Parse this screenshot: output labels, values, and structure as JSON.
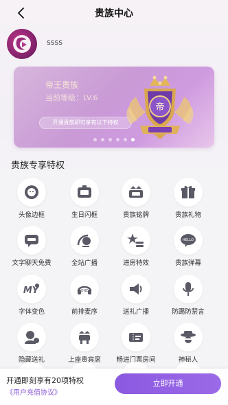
{
  "header": {
    "title": "贵族中心"
  },
  "user": {
    "name": "ssss"
  },
  "banner": {
    "title": "帝王贵族",
    "level": "当前等级：LV.6",
    "pill": "开通贵族即可享有以下特权",
    "badge_char": "帝",
    "dots_count": 6,
    "active_dot": 5
  },
  "section": {
    "title": "贵族专享特权"
  },
  "privileges": [
    {
      "label": "头像边框",
      "icon": "avatar-frame-icon"
    },
    {
      "label": "生日闪框",
      "icon": "birthday-frame-icon"
    },
    {
      "label": "贵族铭牌",
      "icon": "nameplate-icon"
    },
    {
      "label": "贵族礼物",
      "icon": "gift-icon"
    },
    {
      "label": "文字聊天免费",
      "icon": "free-chat-icon"
    },
    {
      "label": "全站广播",
      "icon": "broadcast-icon"
    },
    {
      "label": "进房特效",
      "icon": "entry-effect-icon"
    },
    {
      "label": "贵族弹幕",
      "icon": "danmaku-icon"
    },
    {
      "label": "字体变色",
      "icon": "font-color-icon"
    },
    {
      "label": "前排麦序",
      "icon": "front-mic-icon"
    },
    {
      "label": "送礼广播",
      "icon": "gift-broadcast-icon"
    },
    {
      "label": "防踢防禁言",
      "icon": "anti-kick-icon"
    },
    {
      "label": "隐藏送礼",
      "icon": "hidden-gift-icon"
    },
    {
      "label": "上座贵宾席",
      "icon": "vip-seat-icon"
    },
    {
      "label": "畅进门票房间",
      "icon": "ticket-room-icon"
    },
    {
      "label": "神秘人",
      "icon": "mystery-icon"
    }
  ],
  "bottom": {
    "text": "开通即刻享有20项特权",
    "link": "《用户充值协议》",
    "button": "立即开通"
  },
  "colors": {
    "accent": "#8b59e0",
    "banner": "#cf9be0"
  }
}
